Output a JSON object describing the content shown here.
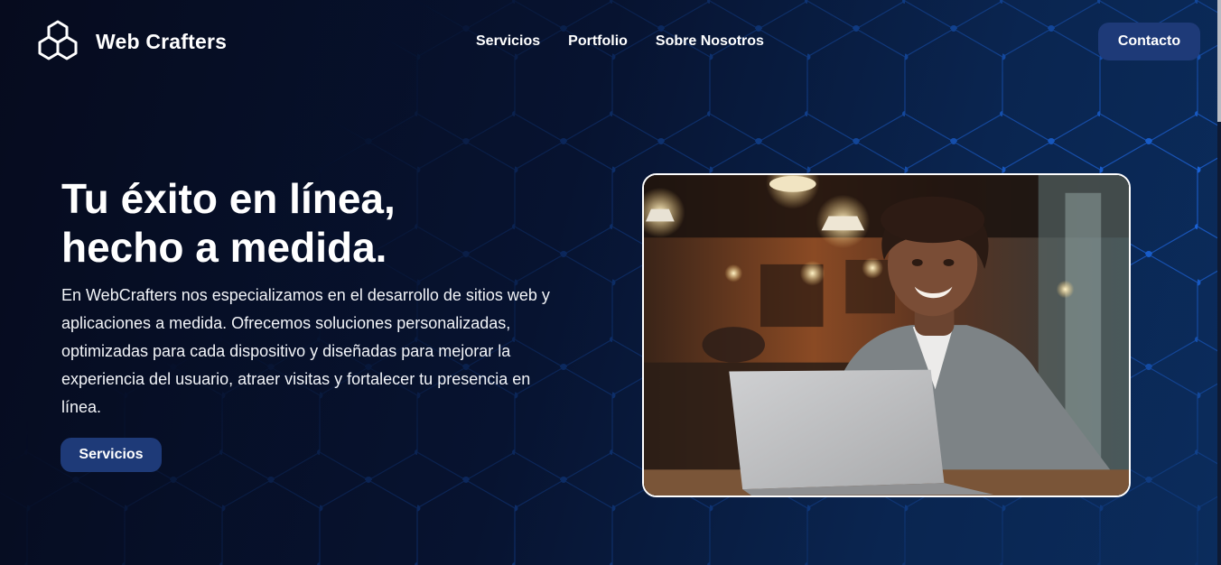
{
  "header": {
    "brand": "Web Crafters",
    "nav": [
      "Servicios",
      "Portfolio",
      "Sobre Nosotros"
    ],
    "cta": "Contacto"
  },
  "hero": {
    "title_line1": "Tu éxito en línea,",
    "title_line2": "hecho a medida.",
    "description": "En WebCrafters nos especializamos en el desarrollo de sitios web y aplicaciones a medida. Ofrecemos soluciones personalizadas, optimizadas para cada dispositivo y diseñadas para mejorar la experiencia del usuario, atraer visitas y fortalecer tu presencia en línea.",
    "button": "Servicios",
    "image_subject": "smiling young man with a laptop in a cafe"
  },
  "icons": [
    "cube-logo-icon"
  ],
  "colors": {
    "background_dark": "#060b1e",
    "background_blue": "#0b2c5c",
    "button": "#1e3a78",
    "network_lines": "#1d63d8",
    "text": "#ffffff"
  }
}
